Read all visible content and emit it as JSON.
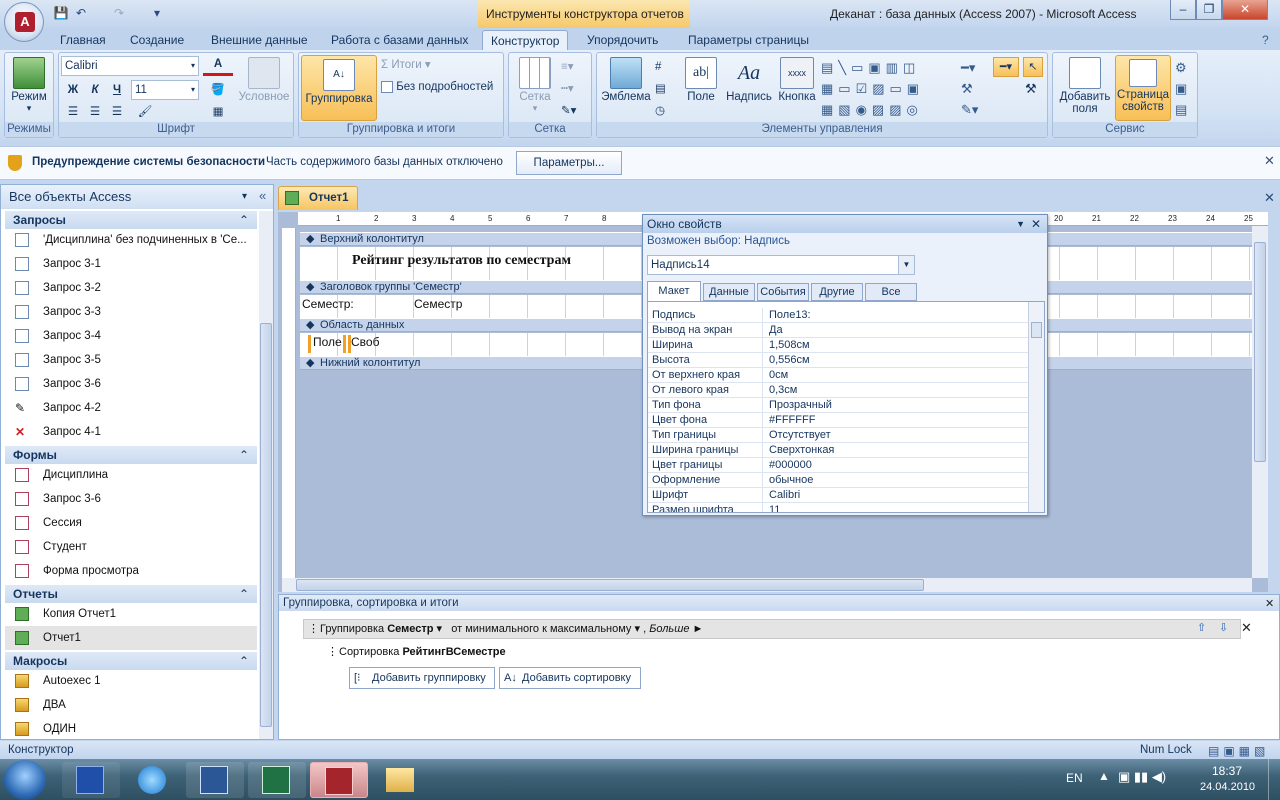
{
  "window": {
    "context_title": "Инструменты конструктора отчетов",
    "title": "Деканат : база данных (Access 2007) - Microsoft Access"
  },
  "tabs": [
    "Главная",
    "Создание",
    "Внешние данные",
    "Работа с базами данных",
    "Конструктор",
    "Упорядочить",
    "Параметры страницы"
  ],
  "ribbon": {
    "views": {
      "button": "Режим",
      "label": "Режимы"
    },
    "font": {
      "family": "Calibri",
      "size": "11",
      "label": "Шрифт",
      "conditional": "Условное",
      "bold": "Ж",
      "italic": "К",
      "underline": "Ч"
    },
    "grouping": {
      "group_button": "Группировка",
      "totals": "Итоги",
      "hide_details": "Без подробностей",
      "label": "Группировка и итоги"
    },
    "gridlines": {
      "button": "Сетка",
      "label": "Сетка"
    },
    "controls": {
      "logo": "Эмблема",
      "field": "Поле",
      "label_btn": "Надпись",
      "button": "Кнопка",
      "label": "Элементы управления",
      "xxxx": "xxxx",
      "abl": "ab|",
      "aa": "Aa"
    },
    "tools": {
      "add_fields": "Добавить поля",
      "property_sheet": "Страница свойств",
      "label": "Сервис"
    }
  },
  "security": {
    "title": "Предупреждение системы безопасности",
    "message": "Часть содержимого базы данных отключено",
    "button": "Параметры..."
  },
  "nav": {
    "header": "Все объекты Access",
    "sections": [
      {
        "title": "Запросы",
        "items": [
          "'Дисциплина' без подчиненных в 'Се...",
          "Запрос 3-1",
          "Запрос 3-2",
          "Запрос 3-3",
          "Запрос 3-4",
          "Запрос 3-5",
          "Запрос 3-6",
          "Запрос 4-2",
          "Запрос 4-1"
        ]
      },
      {
        "title": "Формы",
        "items": [
          "Дисциплина",
          "Запрос 3-6",
          "Сессия",
          "Студент",
          "Форма просмотра"
        ]
      },
      {
        "title": "Отчеты",
        "items": [
          "Копия Отчет1",
          "Отчет1"
        ]
      },
      {
        "title": "Макросы",
        "items": [
          "Autoexec 1",
          "ДВА",
          "ОДИН"
        ]
      }
    ]
  },
  "doc": {
    "tab": "Отчет1",
    "ruler": [
      "1",
      "2",
      "3",
      "4",
      "5",
      "6",
      "7",
      "8",
      "20",
      "21",
      "22",
      "23",
      "24",
      "25"
    ],
    "sections": {
      "page_header": "Верхний колонтитул",
      "group_header": "Заголовок группы 'Семестр'",
      "detail": "Область данных",
      "page_footer": "Нижний колонтитул"
    },
    "report_title": "Рейтинг результатов по семестрам",
    "semester_label": "Семестр:",
    "semester_field": "Семестр",
    "field_label": "Поле",
    "free_label": "Своб"
  },
  "props": {
    "title": "Окно свойств",
    "selection_type": "Возможен выбор:  Надпись",
    "selected": "Надпись14",
    "tabs": [
      "Макет",
      "Данные",
      "События",
      "Другие",
      "Все"
    ],
    "rows": [
      [
        "Подпись",
        "Поле13:"
      ],
      [
        "Вывод на экран",
        "Да"
      ],
      [
        "Ширина",
        "1,508см"
      ],
      [
        "Высота",
        "0,556см"
      ],
      [
        "От верхнего края",
        "0см"
      ],
      [
        "От левого края",
        "0,3см"
      ],
      [
        "Тип фона",
        "Прозрачный"
      ],
      [
        "Цвет фона",
        "#FFFFFF"
      ],
      [
        "Тип границы",
        "Отсутствует"
      ],
      [
        "Ширина границы",
        "Сверхтонкая"
      ],
      [
        "Цвет границы",
        "#000000"
      ],
      [
        "Оформление",
        "обычное"
      ],
      [
        "Шрифт",
        "Calibri"
      ],
      [
        "Размер шрифта",
        "11"
      ]
    ]
  },
  "grouping_pane": {
    "title": "Группировка, сортировка и итоги",
    "group_prefix": "Группировка",
    "group_field": "Семестр",
    "group_order": "от минимального к максимальному",
    "more": "Больше ►",
    "sort_prefix": "Сортировка",
    "sort_field": "РейтингВСеместре",
    "add_group": "Добавить группировку",
    "add_sort": "Добавить сортировку"
  },
  "status": {
    "left": "Конструктор",
    "right": "Num Lock"
  },
  "taskbar": {
    "lang": "EN",
    "time": "18:37",
    "date": "24.04.2010"
  }
}
